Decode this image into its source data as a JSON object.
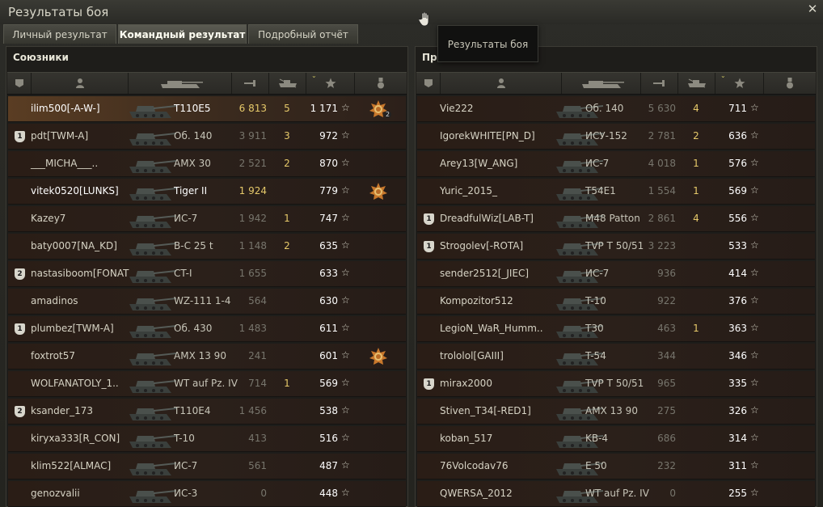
{
  "window": {
    "title": "Результаты боя",
    "close_icon": "close-icon"
  },
  "tabs": [
    {
      "label": "Личный результат",
      "active": false
    },
    {
      "label": "Командный результат",
      "active": true
    },
    {
      "label": "Подробный отчёт",
      "active": false
    }
  ],
  "tooltip": {
    "text": "Результаты боя"
  },
  "columns": [
    "platoon-icon",
    "player-icon",
    "tank-icon",
    "damage-icon",
    "kills-icon",
    "experience-star-icon",
    "medal-icon"
  ],
  "allies": {
    "title": "Союзники",
    "rows": [
      {
        "badge": "",
        "name": "ilim500[-A-W-]",
        "vehicle": "T110E5",
        "damage": "6 813",
        "kills": "5",
        "xp": "1 171",
        "medal": true,
        "medal_count": "2",
        "state": "me"
      },
      {
        "badge": "1",
        "name": "pdt[TWM-A]",
        "vehicle": "Об. 140",
        "damage": "3 911",
        "kills": "3",
        "xp": "972",
        "medal": false,
        "medal_count": "",
        "state": "dead"
      },
      {
        "badge": "",
        "name": "___MICHA___..",
        "vehicle": "AMX 30",
        "damage": "2 521",
        "kills": "2",
        "xp": "870",
        "medal": false,
        "medal_count": "",
        "state": "dead"
      },
      {
        "badge": "",
        "name": "vitek0520[LUNKS]",
        "vehicle": "Tiger II",
        "damage": "1 924",
        "kills": "",
        "xp": "779",
        "medal": true,
        "medal_count": "",
        "state": "alive"
      },
      {
        "badge": "",
        "name": "Kazey7",
        "vehicle": "ИС-7",
        "damage": "1 942",
        "kills": "1",
        "xp": "747",
        "medal": false,
        "medal_count": "",
        "state": "dead"
      },
      {
        "badge": "",
        "name": "baty0007[NA_KD]",
        "vehicle": "B-C 25 t",
        "damage": "1 148",
        "kills": "2",
        "xp": "635",
        "medal": false,
        "medal_count": "",
        "state": "dead"
      },
      {
        "badge": "2",
        "name": "nastasiboom[FONAT",
        "vehicle": "CT-I",
        "damage": "1 655",
        "kills": "",
        "xp": "633",
        "medal": false,
        "medal_count": "",
        "state": "dead"
      },
      {
        "badge": "",
        "name": "amadinos",
        "vehicle": "WZ-111 1-4",
        "damage": "564",
        "kills": "",
        "xp": "630",
        "medal": false,
        "medal_count": "",
        "state": "dead"
      },
      {
        "badge": "1",
        "name": "plumbez[TWM-A]",
        "vehicle": "Об. 430",
        "damage": "1 483",
        "kills": "",
        "xp": "611",
        "medal": false,
        "medal_count": "",
        "state": "dead"
      },
      {
        "badge": "",
        "name": "foxtrot57",
        "vehicle": "AMX 13 90",
        "damage": "241",
        "kills": "",
        "xp": "601",
        "medal": true,
        "medal_count": "",
        "state": "dead"
      },
      {
        "badge": "",
        "name": "WOLFANATOLY_1..",
        "vehicle": "WT auf Pz. IV",
        "damage": "714",
        "kills": "1",
        "xp": "569",
        "medal": false,
        "medal_count": "",
        "state": "dead"
      },
      {
        "badge": "2",
        "name": "ksander_173",
        "vehicle": "T110E4",
        "damage": "1 456",
        "kills": "",
        "xp": "538",
        "medal": false,
        "medal_count": "",
        "state": "dead"
      },
      {
        "badge": "",
        "name": "kiryxa333[R_CON]",
        "vehicle": "T-10",
        "damage": "413",
        "kills": "",
        "xp": "516",
        "medal": false,
        "medal_count": "",
        "state": "dead"
      },
      {
        "badge": "",
        "name": "klim522[ALMAC]",
        "vehicle": "ИС-7",
        "damage": "561",
        "kills": "",
        "xp": "487",
        "medal": false,
        "medal_count": "",
        "state": "dead"
      },
      {
        "badge": "",
        "name": "genozvalii",
        "vehicle": "ИС-3",
        "damage": "0",
        "kills": "",
        "xp": "448",
        "medal": false,
        "medal_count": "",
        "state": "dead"
      }
    ]
  },
  "enemies": {
    "title": "Про",
    "rows": [
      {
        "badge": "",
        "name": "Vie222",
        "vehicle": "Об. 140",
        "damage": "5 630",
        "kills": "4",
        "xp": "711"
      },
      {
        "badge": "",
        "name": "IgorekWHITE[PN_D]",
        "vehicle": "ИСУ-152",
        "damage": "2 781",
        "kills": "2",
        "xp": "636"
      },
      {
        "badge": "",
        "name": "Arey13[W_ANG]",
        "vehicle": "ИС-7",
        "damage": "4 018",
        "kills": "1",
        "xp": "576"
      },
      {
        "badge": "",
        "name": "Yuric_2015_",
        "vehicle": "T54E1",
        "damage": "1 554",
        "kills": "1",
        "xp": "569"
      },
      {
        "badge": "1",
        "name": "DreadfulWiz[LAB-T]",
        "vehicle": "M48 Patton",
        "damage": "2 861",
        "kills": "4",
        "xp": "556"
      },
      {
        "badge": "1",
        "name": "Strogolev[-ROTA]",
        "vehicle": "TVP T 50/51",
        "damage": "3 223",
        "kills": "",
        "xp": "533"
      },
      {
        "badge": "",
        "name": "sender2512[_JIEC]",
        "vehicle": "ИС-7",
        "damage": "936",
        "kills": "",
        "xp": "414"
      },
      {
        "badge": "",
        "name": "Kompozitor512",
        "vehicle": "T-10",
        "damage": "922",
        "kills": "",
        "xp": "376"
      },
      {
        "badge": "",
        "name": "LegioN_WaR_Humm..",
        "vehicle": "T30",
        "damage": "463",
        "kills": "1",
        "xp": "363"
      },
      {
        "badge": "",
        "name": "trololol[GAIII]",
        "vehicle": "T-54",
        "damage": "344",
        "kills": "",
        "xp": "346"
      },
      {
        "badge": "1",
        "name": "mirax2000",
        "vehicle": "TVP T 50/51",
        "damage": "965",
        "kills": "",
        "xp": "335"
      },
      {
        "badge": "",
        "name": "Stiven_T34[-RED1]",
        "vehicle": "AMX 13 90",
        "damage": "275",
        "kills": "",
        "xp": "326"
      },
      {
        "badge": "",
        "name": "koban_517",
        "vehicle": "KB-4",
        "damage": "686",
        "kills": "",
        "xp": "314"
      },
      {
        "badge": "",
        "name": "76Volcodav76",
        "vehicle": "E 50",
        "damage": "232",
        "kills": "",
        "xp": "311"
      },
      {
        "badge": "",
        "name": "QWERSA_2012",
        "vehicle": "WT auf Pz. IV",
        "damage": "0",
        "kills": "",
        "xp": "255"
      }
    ]
  }
}
